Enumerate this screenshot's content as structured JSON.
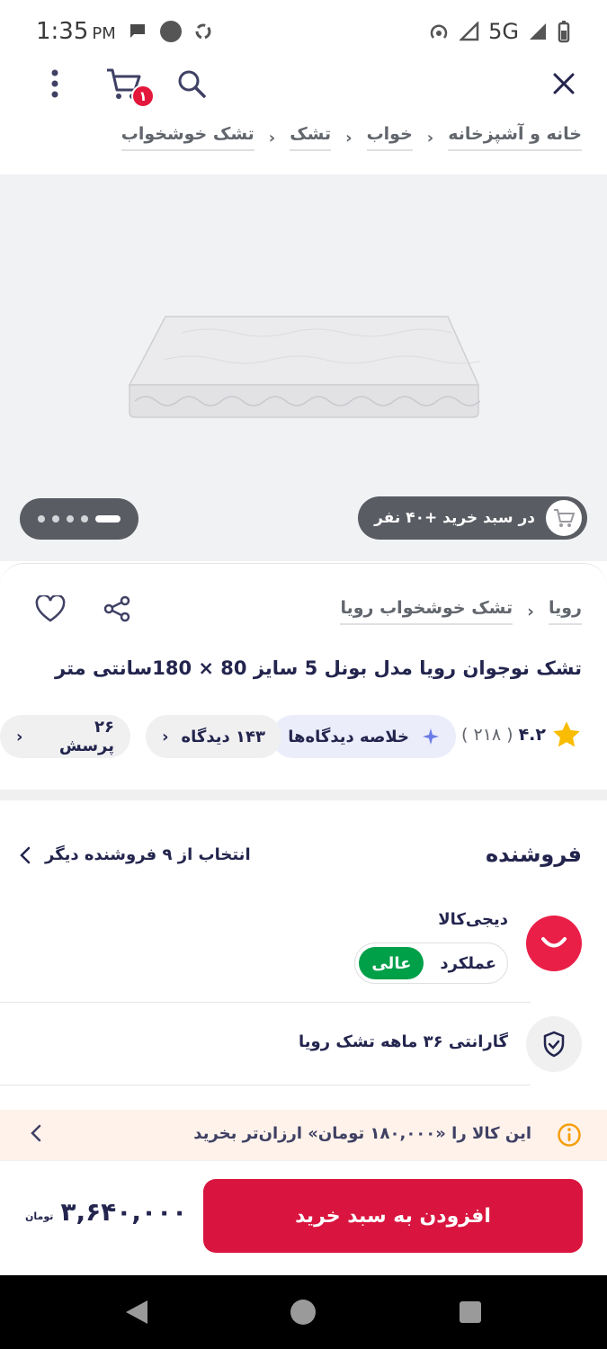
{
  "status_bar": {
    "time": "1:35",
    "ampm": "PM",
    "network": "5G"
  },
  "top_bar": {
    "cart_count": "۱"
  },
  "breadcrumb": [
    "خانه و آشپزخانه",
    "خواب",
    "تشک",
    "تشک خوشخواب"
  ],
  "gallery": {
    "dots_total": 5,
    "active_dot": 1,
    "social_proof": "در سبد خرید +۴۰ نفر"
  },
  "product": {
    "brand": "رویا",
    "category_link": "تشک خوشخواب رویا",
    "title": "تشک نوجوان رویا مدل بونل 5 سایز 80 × 180سانتی متر",
    "rating_score": "۴.۲",
    "rating_count": "( ۲۱۸ )",
    "chips": {
      "reviews_summary": "خلاصه دیدگاه‌ها",
      "reviews": "۱۴۳ دیدگاه",
      "questions": "۲۶ پرسش"
    }
  },
  "seller": {
    "heading": "فروشنده",
    "other_sellers": "انتخاب از ۹ فروشنده دیگر",
    "name": "دیجی‌کالا",
    "performance_label": "عملکرد",
    "performance_value": "عالی",
    "warranty": "گارانتی ۳۶ ماهه تشک رویا"
  },
  "promo": {
    "text": "این کالا را «۱۸۰,۰۰۰ تومان» ارزان‌تر بخرید"
  },
  "bottom": {
    "add_to_cart": "افزودن به سبد خرید",
    "price": "۳,۶۴۰,۰۰۰",
    "currency": "تومان"
  },
  "colors": {
    "accent": "#d9153f",
    "badge_green": "#00a049",
    "star": "#f9bc00"
  }
}
